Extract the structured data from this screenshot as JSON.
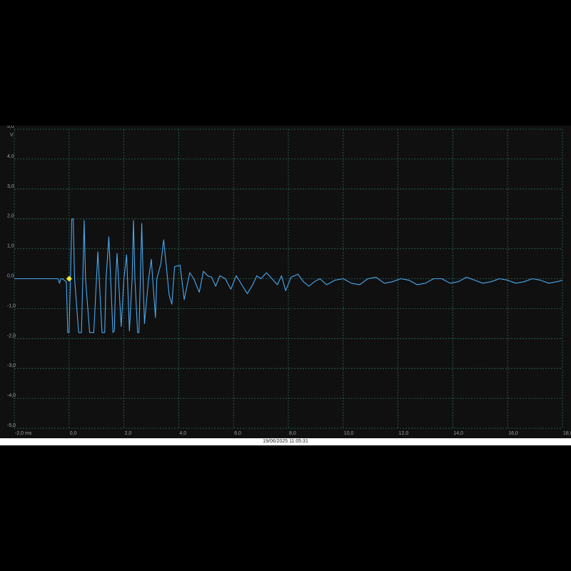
{
  "colors": {
    "background": "#101010",
    "grid": "#2c6a58",
    "trace": "#4aa8f0",
    "trigger_marker": "#f6ea2c"
  },
  "trigger_marker_icon": "yellow-diamond",
  "timestamp": "19/06/2025 11:05:31",
  "chart_data": {
    "type": "line",
    "title": "",
    "xlabel": "",
    "ylabel": "",
    "x_unit": "ms",
    "y_unit": "V",
    "xlim": [
      -2.0,
      18.0
    ],
    "ylim": [
      -5.0,
      5.0
    ],
    "grid": true,
    "x_tick_labels": [
      "-2,0 ms",
      "0,0",
      "2,0",
      "4,0",
      "6,0",
      "8,0",
      "10,0",
      "12,0",
      "14,0",
      "16,0",
      "18,0"
    ],
    "y_tick_labels": [
      "5,0",
      "4,0",
      "3,0",
      "2,0",
      "1,0",
      "0,0",
      "-1,0",
      "-2,0",
      "-3,0",
      "-4,0",
      "-5,0"
    ],
    "y_tick_values": [
      5,
      4,
      3,
      2,
      1,
      0,
      -1,
      -2,
      -3,
      -4,
      -5
    ],
    "y_unit_label": "V",
    "trigger": {
      "x": 0.0,
      "y": 0.0
    },
    "series": [
      {
        "values_note_free": true,
        "x": [
          -2.0,
          -0.4,
          -0.35,
          -0.3,
          -0.25,
          -0.1,
          -0.05,
          0.0,
          0.05,
          0.1,
          0.15,
          0.2,
          0.35,
          0.45,
          0.5,
          0.55,
          0.6,
          0.75,
          0.9,
          1.0,
          1.05,
          1.2,
          1.3,
          1.35,
          1.45,
          1.6,
          1.65,
          1.7,
          1.75,
          1.9,
          2.0,
          2.1,
          2.2,
          2.3,
          2.35,
          2.4,
          2.5,
          2.55,
          2.6,
          2.65,
          2.7,
          2.75,
          2.9,
          3.0,
          3.05,
          3.15,
          3.2,
          3.35,
          3.45,
          3.55,
          3.65,
          3.75,
          3.85,
          4.05,
          4.2,
          4.4,
          4.55,
          4.75,
          4.9,
          5.05,
          5.2,
          5.35,
          5.5,
          5.7,
          5.9,
          6.1,
          6.3,
          6.5,
          6.7,
          6.85,
          7.0,
          7.2,
          7.45,
          7.6,
          7.75,
          7.9,
          8.1,
          8.35,
          8.55,
          8.75,
          8.95,
          9.15,
          9.4,
          9.7,
          10.0,
          10.3,
          10.6,
          10.9,
          11.2,
          11.5,
          11.8,
          12.1,
          12.4,
          12.7,
          13.0,
          13.3,
          13.6,
          13.9,
          14.2,
          14.5,
          14.8,
          15.1,
          15.4,
          15.7,
          16.0,
          16.3,
          16.6,
          16.9,
          17.2,
          17.5,
          17.8,
          18.0
        ],
        "y": [
          0.0,
          0.0,
          -0.15,
          0.0,
          0.0,
          -0.1,
          -1.8,
          -1.8,
          0.0,
          2.0,
          2.0,
          0.0,
          -1.8,
          -1.8,
          0.0,
          1.95,
          0.0,
          -1.8,
          -1.8,
          0.0,
          0.9,
          -1.8,
          -1.8,
          0.0,
          1.4,
          -1.8,
          -1.75,
          0.0,
          0.85,
          -1.6,
          0.0,
          0.8,
          -1.75,
          0.0,
          1.95,
          0.0,
          -1.8,
          -1.8,
          0.0,
          1.85,
          0.0,
          -1.5,
          0.0,
          0.65,
          0.0,
          -1.3,
          0.0,
          0.5,
          1.3,
          0.4,
          -0.55,
          -0.85,
          0.4,
          0.45,
          -0.7,
          0.2,
          0.0,
          -0.45,
          0.25,
          0.1,
          0.05,
          -0.25,
          0.1,
          0.0,
          -0.35,
          0.1,
          -0.2,
          -0.5,
          -0.2,
          0.1,
          0.0,
          0.2,
          -0.05,
          -0.2,
          0.1,
          -0.4,
          0.05,
          0.15,
          -0.1,
          -0.25,
          -0.1,
          0.0,
          -0.2,
          -0.05,
          0.0,
          -0.15,
          -0.2,
          0.0,
          0.05,
          -0.15,
          -0.1,
          0.0,
          -0.05,
          -0.2,
          -0.15,
          0.0,
          0.0,
          -0.15,
          -0.1,
          0.05,
          -0.05,
          -0.15,
          -0.1,
          0.0,
          -0.05,
          -0.15,
          -0.1,
          0.0,
          -0.05,
          -0.15,
          -0.1,
          -0.05
        ]
      }
    ]
  }
}
